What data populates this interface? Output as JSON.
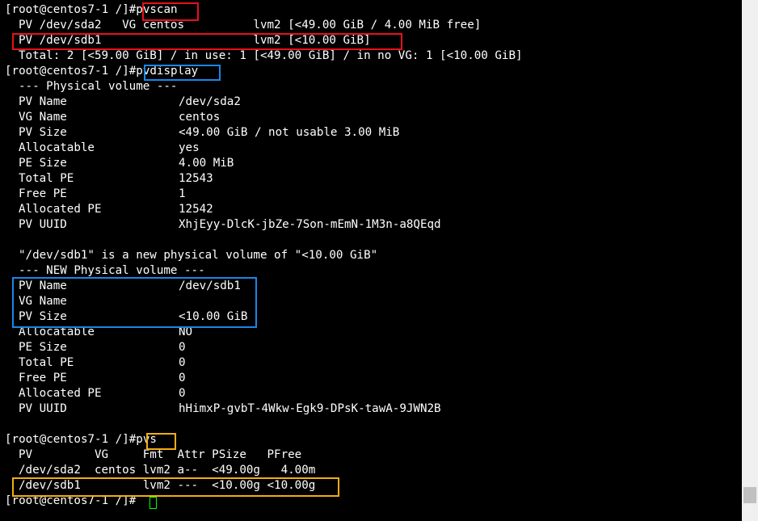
{
  "terminal": {
    "prompt": "[root@centos7-1 /]#",
    "commands": {
      "pvscan": "pvscan",
      "pvdisplay": "pvdisplay",
      "pvs": "pvs"
    },
    "pvscan": {
      "row1": "PV /dev/sda2   VG centos          lvm2 [<49.00 GiB / 4.00 MiB free]",
      "row2": "PV /dev/sdb1                      lvm2 [<10.00 GiB]",
      "total": "Total: 2 [<59.00 GiB] / in use: 1 [<49.00 GiB] / in no VG: 1 [<10.00 GiB]"
    },
    "pvdisplay": {
      "header1": "--- Physical volume ---",
      "pv1": [
        {
          "label": "PV Name",
          "value": "/dev/sda2"
        },
        {
          "label": "VG Name",
          "value": "centos"
        },
        {
          "label": "PV Size",
          "value": "<49.00 GiB / not usable 3.00 MiB"
        },
        {
          "label": "Allocatable",
          "value": "yes"
        },
        {
          "label": "PE Size",
          "value": "4.00 MiB"
        },
        {
          "label": "Total PE",
          "value": "12543"
        },
        {
          "label": "Free PE",
          "value": "1"
        },
        {
          "label": "Allocated PE",
          "value": "12542"
        },
        {
          "label": "PV UUID",
          "value": "XhjEyy-DlcK-jbZe-7Son-mEmN-1M3n-a8QEqd"
        }
      ],
      "new_notice": "\"/dev/sdb1\" is a new physical volume of \"<10.00 GiB\"",
      "header2": "--- NEW Physical volume ---",
      "pv2": [
        {
          "label": "PV Name",
          "value": "/dev/sdb1"
        },
        {
          "label": "VG Name",
          "value": ""
        },
        {
          "label": "PV Size",
          "value": "<10.00 GiB"
        },
        {
          "label": "Allocatable",
          "value": "NO"
        },
        {
          "label": "PE Size",
          "value": "0"
        },
        {
          "label": "Total PE",
          "value": "0"
        },
        {
          "label": "Free PE",
          "value": "0"
        },
        {
          "label": "Allocated PE",
          "value": "0"
        },
        {
          "label": "PV UUID",
          "value": "hHimxP-gvbT-4Wkw-Egk9-DPsK-tawA-9JWN2B"
        }
      ]
    },
    "pvs": {
      "header": "PV         VG     Fmt  Attr PSize   PFree",
      "row1": "/dev/sda2  centos lvm2 a--  <49.00g   4.00m",
      "row2": "/dev/sdb1         lvm2 ---  <10.00g <10.00g"
    }
  },
  "colors": {
    "background": "#000000",
    "text": "#ffffff",
    "highlight_red": "#e8111a",
    "highlight_blue": "#1a86e8",
    "highlight_orange": "#f2ad0f",
    "cursor": "#00ff00"
  }
}
